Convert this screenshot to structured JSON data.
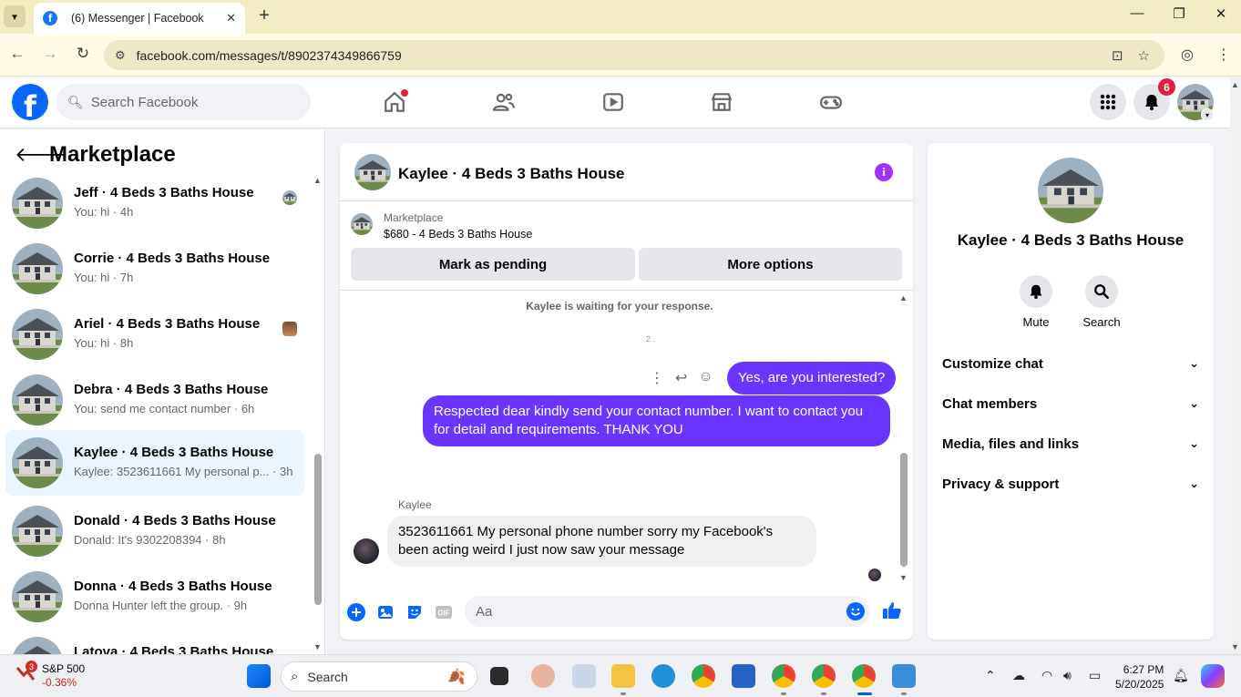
{
  "browser": {
    "tab_title": "(6) Messenger | Facebook",
    "url": "facebook.com/messages/t/8902374349866759"
  },
  "fb_header": {
    "search_placeholder": "Search Facebook",
    "notification_count": "6",
    "nav_icons": [
      "home-icon",
      "friends-icon",
      "video-icon",
      "marketplace-icon",
      "gaming-icon"
    ]
  },
  "sidebar": {
    "title": "Marketplace",
    "conversations": [
      {
        "name": "Jeff · 4 Beds 3 Baths House",
        "preview": "You: hi",
        "time": "4h"
      },
      {
        "name": "Corrie · 4 Beds 3 Baths House",
        "preview": "You: hi",
        "time": "7h"
      },
      {
        "name": "Ariel · 4 Beds 3 Baths House",
        "preview": "You: hi",
        "time": "8h"
      },
      {
        "name": "Debra · 4 Beds 3 Baths House",
        "preview": "You: send me contact number",
        "time": "6h"
      },
      {
        "name": "Kaylee · 4 Beds 3 Baths House",
        "preview": "Kaylee: 3523611661 My personal p...",
        "time": "3h"
      },
      {
        "name": "Donald · 4 Beds 3 Baths House",
        "preview": "Donald: It's 9302208394",
        "time": "8h"
      },
      {
        "name": "Donna · 4 Beds 3 Baths House",
        "preview": "Donna Hunter left the group.",
        "time": "9h"
      },
      {
        "name": "Latova · 4 Beds 3 Baths House",
        "preview": "",
        "time": ""
      }
    ]
  },
  "chat": {
    "title": "Kaylee · 4 Beds 3 Baths House",
    "marketplace_label": "Marketplace",
    "listing": "$680 - 4 Beds 3 Baths House",
    "mark_pending_label": "Mark as pending",
    "more_options_label": "More options",
    "waiting_note": "Kaylee is waiting for your response.",
    "small_note": "2  .",
    "messages": {
      "out1": "Yes, are you interested?",
      "out2": "Respected dear kindly send your contact number. I want to contact you for detail and requirements. THANK YOU",
      "in_sender": "Kaylee",
      "in1": "3523611661 My personal phone number sorry my Facebook's been acting weird I just now saw your message"
    },
    "composer_placeholder": "Aa"
  },
  "info_panel": {
    "title": "Kaylee · 4 Beds 3 Baths House",
    "mute_label": "Mute",
    "search_label": "Search",
    "sections": [
      "Customize chat",
      "Chat members",
      "Media, files and links",
      "Privacy & support"
    ]
  },
  "taskbar": {
    "stock_badge": "3",
    "stock_name": "S&P 500",
    "stock_change": "-0.36%",
    "search_label": "Search",
    "time": "6:27 PM",
    "date": "5/20/2025"
  },
  "colors": {
    "fb_blue": "#0866ff",
    "messenger_purple": "#6a35ff",
    "notification_red": "#e41e3f"
  }
}
